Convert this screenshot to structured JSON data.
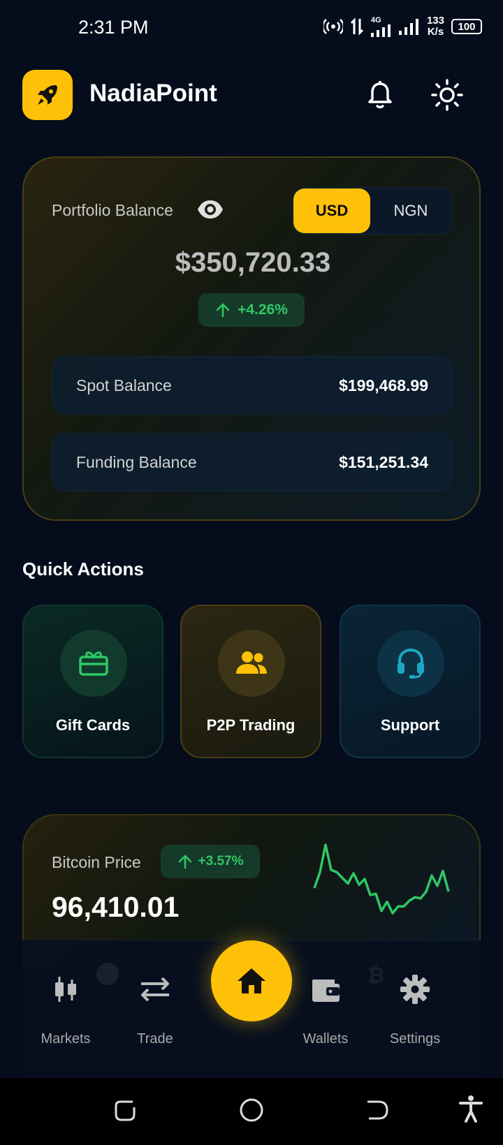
{
  "status_bar": {
    "time": "2:31 PM",
    "network": "4G",
    "speed_value": "133",
    "speed_unit": "K/s",
    "battery": "100"
  },
  "header": {
    "app_name": "NadiaPoint",
    "logo_icon": "rocket-icon",
    "bell_icon": "bell-icon",
    "theme_icon": "sun-icon"
  },
  "portfolio": {
    "label": "Portfolio Balance",
    "currency_options": [
      "USD",
      "NGN"
    ],
    "selected_currency": "USD",
    "total": "$350,720.33",
    "change": "+4.26%",
    "rows": [
      {
        "label": "Spot Balance",
        "value": "$199,468.99"
      },
      {
        "label": "Funding Balance",
        "value": "$151,251.34"
      }
    ]
  },
  "quick_actions": {
    "title": "Quick Actions",
    "items": [
      {
        "label": "Gift Cards",
        "icon": "gift-card-icon",
        "color": "#2fc765"
      },
      {
        "label": "P2P Trading",
        "icon": "users-icon",
        "color": "#ffc107"
      },
      {
        "label": "Support",
        "icon": "headset-icon",
        "color": "#1ea7c4"
      }
    ]
  },
  "bitcoin": {
    "label": "Bitcoin Price",
    "change": "+3.57%",
    "price": "96,410.01",
    "sparkline": [
      18,
      46,
      94,
      50,
      46,
      36,
      26,
      44,
      24,
      34,
      6,
      8,
      -22,
      -6,
      -26,
      -14,
      -14,
      -4,
      2,
      0,
      12,
      40,
      22,
      48,
      12
    ]
  },
  "bottom_nav": {
    "items": [
      {
        "label": "Markets",
        "icon": "candlestick-icon"
      },
      {
        "label": "Trade",
        "icon": "swap-arrows-icon"
      },
      {
        "label": "Home",
        "icon": "home-icon"
      },
      {
        "label": "Wallets",
        "icon": "wallet-icon"
      },
      {
        "label": "Settings",
        "icon": "gear-icon"
      }
    ]
  },
  "colors": {
    "accent": "#ffc107",
    "positive": "#2fc765",
    "background": "#050d1c"
  }
}
